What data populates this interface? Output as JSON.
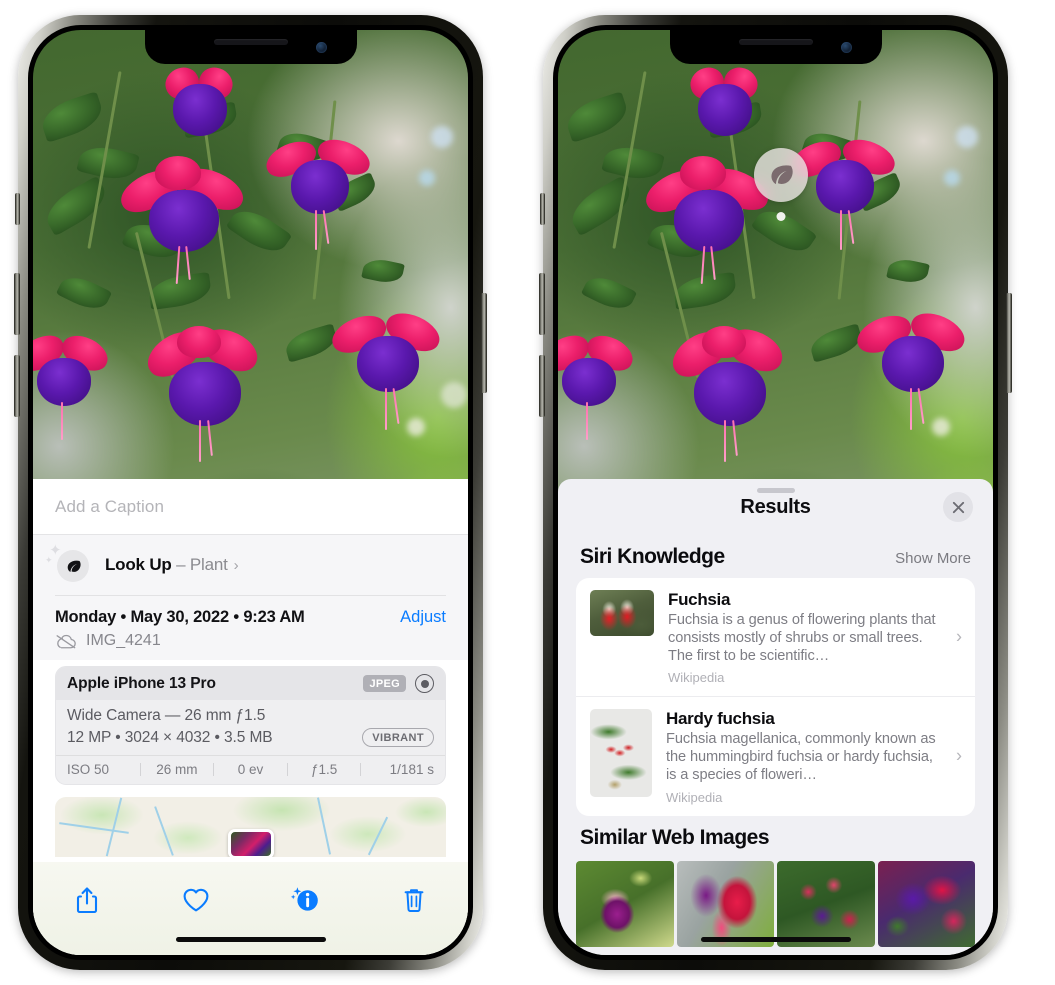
{
  "left_phone": {
    "caption": {
      "placeholder": "Add a Caption",
      "value": ""
    },
    "lookup": {
      "label": "Look Up",
      "dash": "–",
      "category": "Plant",
      "icon": "leaf-icon",
      "chevron": "›"
    },
    "date": {
      "weekday": "Monday",
      "sep1": "•",
      "date": "May 30, 2022",
      "sep2": "•",
      "time": "9:23 AM",
      "full": "Monday • May 30, 2022 • 9:23 AM"
    },
    "adjust_label": "Adjust",
    "filename": "IMG_4241",
    "cloud_icon": "cloud-slash-icon",
    "exif": {
      "device": "Apple iPhone 13 Pro",
      "format_chip": "JPEG",
      "lens_icon": "aperture-icon",
      "lens_line": "Wide Camera — 26 mm ƒ1.5",
      "size_line": "12 MP • 3024 × 4032 • 3.5 MB",
      "style_chip": "VIBRANT",
      "stats": [
        "ISO 50",
        "26 mm",
        "0 ev",
        "ƒ1.5",
        "1/181 s"
      ]
    },
    "toolbar": [
      {
        "name": "share-icon",
        "label": "Share"
      },
      {
        "name": "heart-icon",
        "label": "Favorite"
      },
      {
        "name": "info-sparkle-icon",
        "label": "Info"
      },
      {
        "name": "trash-icon",
        "label": "Delete"
      }
    ]
  },
  "right_phone": {
    "badge": {
      "icon": "leaf-icon"
    },
    "sheet": {
      "title": "Results",
      "close_icon": "close-icon",
      "sections": [
        {
          "title": "Siri Knowledge",
          "action": "Show More",
          "items": [
            {
              "title": "Fuchsia",
              "description": "Fuchsia is a genus of flowering plants that consists mostly of shrubs or small trees. The first to be scientific…",
              "source": "Wikipedia",
              "thumb": "fuchsia-wiki-thumb",
              "chevron": "›"
            },
            {
              "title": "Hardy fuchsia",
              "description": "Fuchsia magellanica, commonly known as the hummingbird fuchsia or hardy fuchsia, is a species of floweri…",
              "source": "Wikipedia",
              "thumb": "hardy-fuchsia-thumb",
              "chevron": "›"
            }
          ]
        },
        {
          "title": "Similar Web Images",
          "action": "",
          "thumbs": [
            "sim-image-1",
            "sim-image-2",
            "sim-image-3",
            "sim-image-4"
          ]
        }
      ]
    }
  },
  "colors": {
    "accent_blue": "#0a7cff",
    "sheet_bg": "#f0f0f4",
    "card_bg": "#ffffff",
    "info_bg": "#f6f6f8",
    "exif_bg": "#efeff1",
    "muted_text": "#7d7d84"
  }
}
